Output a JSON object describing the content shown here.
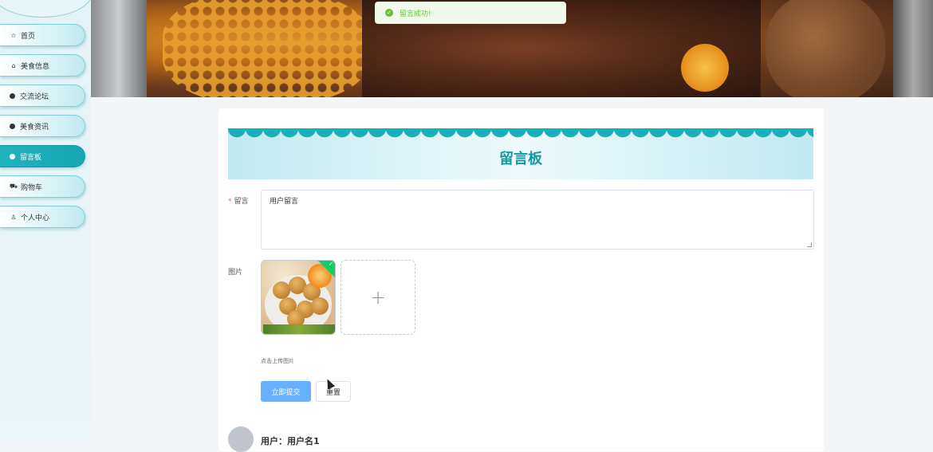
{
  "sidebar": {
    "items": [
      {
        "label": "首页",
        "icon": "star-icon",
        "glyph": "☆",
        "active": false
      },
      {
        "label": "美食信息",
        "icon": "bag-icon",
        "glyph": "⌂",
        "active": false
      },
      {
        "label": "交流论坛",
        "icon": "dot-icon",
        "glyph": "",
        "active": false
      },
      {
        "label": "美食资讯",
        "icon": "dot-icon",
        "glyph": "",
        "active": false
      },
      {
        "label": "留言板",
        "icon": "dot-icon",
        "glyph": "",
        "active": true
      },
      {
        "label": "购物车",
        "icon": "cart-icon",
        "glyph": "⛟",
        "active": false
      },
      {
        "label": "个人中心",
        "icon": "user-icon",
        "glyph": "♙",
        "active": false
      }
    ]
  },
  "toast": {
    "text": "留言成功!",
    "icon": "check-circle-icon"
  },
  "board": {
    "title": "留言板"
  },
  "form": {
    "message_label": "留言",
    "required_mark": "*",
    "message_value": "用户留言",
    "image_label": "图片",
    "upload_plus": "+",
    "upload_tip": "点击上传图片",
    "submit_label": "立即提交",
    "reset_label": "重置"
  },
  "comment": {
    "user": "用户：用户名1"
  },
  "colors": {
    "accent": "#17a6b2",
    "primary_button": "#66b1ff",
    "success": "#67c23a"
  }
}
